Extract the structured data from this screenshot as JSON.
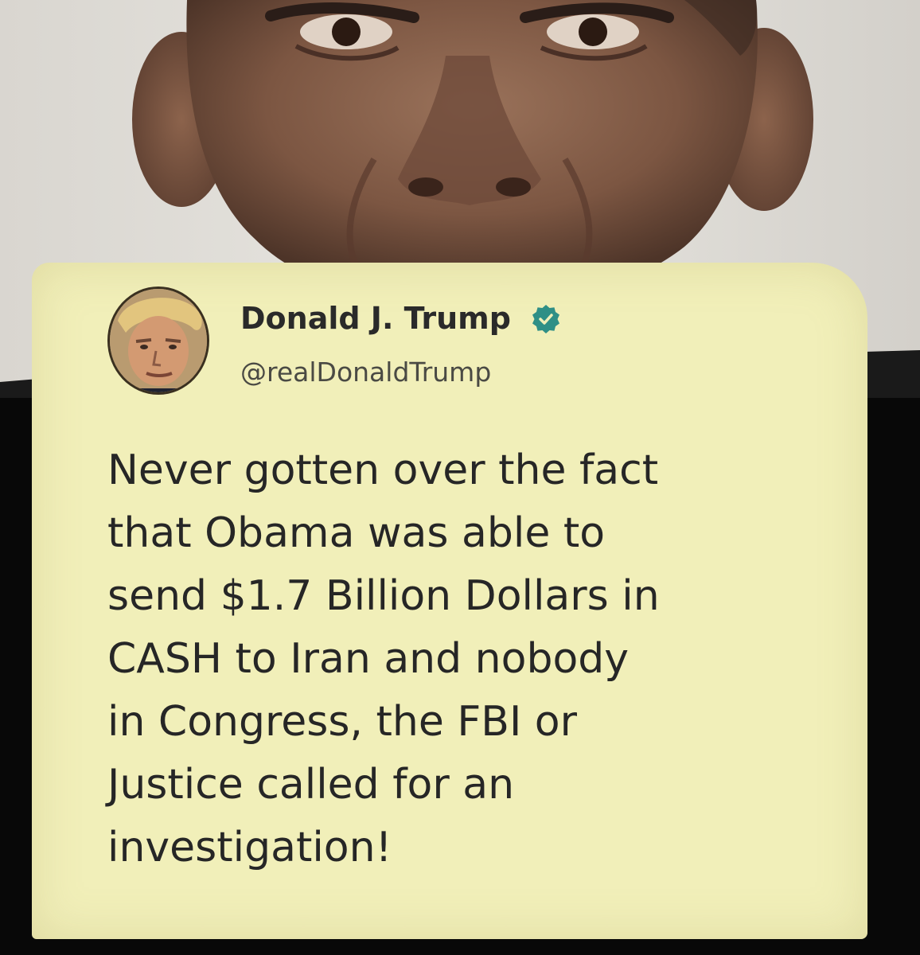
{
  "tweet": {
    "display_name": "Donald J. Trump",
    "handle": "@realDonaldTrump",
    "verified": true,
    "text": "Never gotten over the fact\nthat Obama was able to\nsend $1.7 Billion Dollars in\nCASH to Iran and nobody\nin Congress, the FBI or\nJustice called for an\ninvestigation!"
  },
  "icons": {
    "verified": "verified-badge-icon",
    "avatar": "profile-avatar"
  },
  "colors": {
    "card_background": "#f1efb9",
    "verified_badge": "#2f8f86",
    "text": "#262626"
  }
}
